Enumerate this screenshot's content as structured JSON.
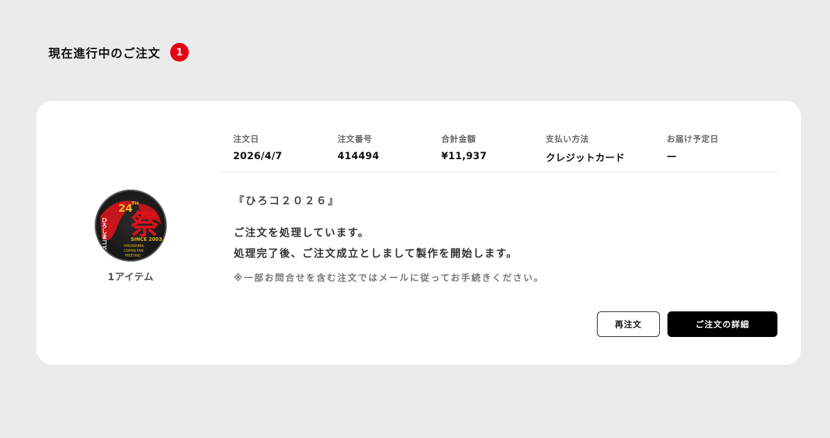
{
  "header": {
    "title": "現在進行中のご注文",
    "count": "1"
  },
  "order": {
    "meta": [
      {
        "label": "注文日",
        "value": "2026/4/7"
      },
      {
        "label": "注文番号",
        "value": "414494"
      },
      {
        "label": "合計金額",
        "value": "¥11,937"
      },
      {
        "label": "支払い方法",
        "value": "クレジットカード"
      },
      {
        "label": "お届け予定日",
        "value": "—"
      }
    ],
    "item_count": "1アイテム",
    "product_name": "『ひろコ２０２６』",
    "status_line1": "ご注文を処理しています。",
    "status_line2": "処理完了後、ご注文成立としまして製作を開始します。",
    "notice": "※一部お問合せを含む注文ではメールに従ってお手続きください。",
    "buttons": {
      "reorder": "再注文",
      "detail": "ご注文の詳細"
    }
  },
  "badge_art": {
    "big_char": "祭",
    "number": "24",
    "suffix": "TH",
    "since": "SINCE 2003",
    "line1": "HIROSHIMA",
    "line2": "COPEN FAN",
    "line3": "MEETING",
    "side_text": "ひろしまコペン好きの"
  },
  "colors": {
    "accent_red": "#e60012",
    "badge_red": "#d8141c",
    "badge_gold": "#e8b923"
  }
}
